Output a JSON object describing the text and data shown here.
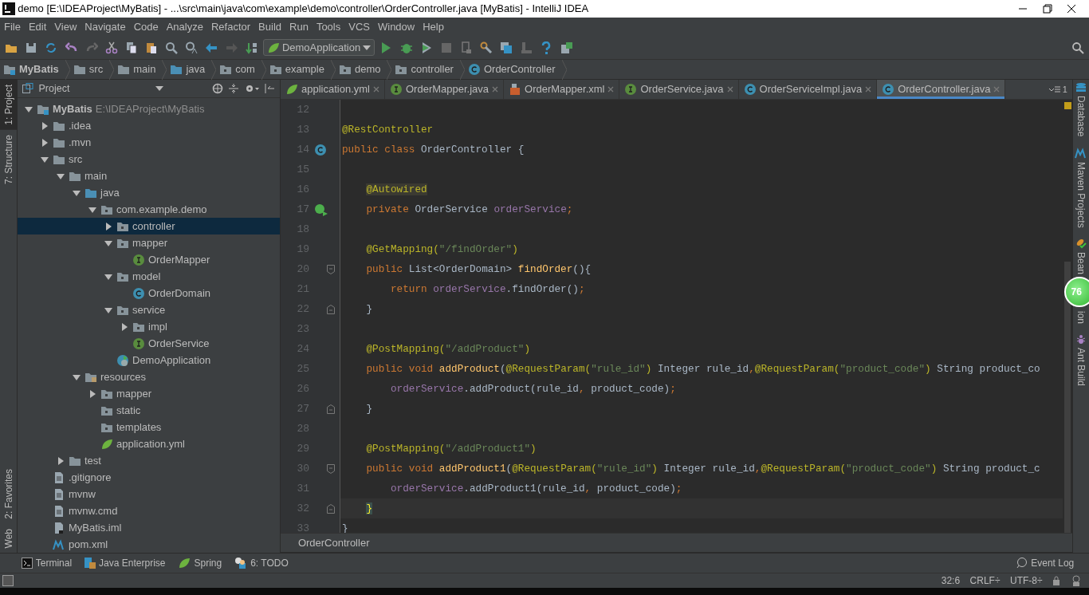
{
  "window": {
    "title": "demo [E:\\IDEAProject\\MyBatis] - ...\\src\\main\\java\\com\\example\\demo\\controller\\OrderController.java [MyBatis] - IntelliJ IDEA"
  },
  "menu": [
    "File",
    "Edit",
    "View",
    "Navigate",
    "Code",
    "Analyze",
    "Refactor",
    "Build",
    "Run",
    "Tools",
    "VCS",
    "Window",
    "Help"
  ],
  "run_config": "DemoApplication",
  "breadcrumbs": [
    {
      "label": "MyBatis",
      "kind": "module"
    },
    {
      "label": "src",
      "kind": "folder"
    },
    {
      "label": "main",
      "kind": "folder"
    },
    {
      "label": "java",
      "kind": "source"
    },
    {
      "label": "com",
      "kind": "package"
    },
    {
      "label": "example",
      "kind": "package"
    },
    {
      "label": "demo",
      "kind": "package"
    },
    {
      "label": "controller",
      "kind": "package"
    },
    {
      "label": "OrderController",
      "kind": "class"
    }
  ],
  "left_tools": [
    {
      "label": "1: Project",
      "selected": true
    },
    {
      "label": "7: Structure",
      "selected": false
    },
    {
      "label": "2: Favorites",
      "selected": false
    },
    {
      "label": "Web",
      "selected": false
    }
  ],
  "project_panel": {
    "title": "Project",
    "tree": [
      {
        "label": "MyBatis",
        "path": "E:\\IDEAProject\\MyBatis",
        "kind": "module",
        "expanded": true,
        "selected": false,
        "children": [
          {
            "label": ".idea",
            "kind": "folder",
            "expanded": false,
            "selected": false
          },
          {
            "label": ".mvn",
            "kind": "folder",
            "expanded": false,
            "selected": false
          },
          {
            "label": "src",
            "kind": "folder",
            "expanded": true,
            "selected": false,
            "children": [
              {
                "label": "main",
                "kind": "folder",
                "expanded": true,
                "selected": false,
                "children": [
                  {
                    "label": "java",
                    "kind": "source",
                    "expanded": true,
                    "selected": false,
                    "children": [
                      {
                        "label": "com.example.demo",
                        "kind": "package",
                        "expanded": true,
                        "selected": false,
                        "children": [
                          {
                            "label": "controller",
                            "kind": "package",
                            "expanded": false,
                            "selected": true
                          },
                          {
                            "label": "mapper",
                            "kind": "package",
                            "expanded": true,
                            "selected": false,
                            "children": [
                              {
                                "label": "OrderMapper",
                                "kind": "interface",
                                "selected": false
                              }
                            ]
                          },
                          {
                            "label": "model",
                            "kind": "package",
                            "expanded": true,
                            "selected": false,
                            "children": [
                              {
                                "label": "OrderDomain",
                                "kind": "class",
                                "selected": false
                              }
                            ]
                          },
                          {
                            "label": "service",
                            "kind": "package",
                            "expanded": true,
                            "selected": false,
                            "children": [
                              {
                                "label": "impl",
                                "kind": "package",
                                "expanded": false,
                                "selected": false
                              },
                              {
                                "label": "OrderService",
                                "kind": "interface",
                                "selected": false
                              }
                            ]
                          },
                          {
                            "label": "DemoApplication",
                            "kind": "springclass",
                            "selected": false
                          }
                        ]
                      }
                    ]
                  },
                  {
                    "label": "resources",
                    "kind": "resources",
                    "expanded": true,
                    "selected": false,
                    "children": [
                      {
                        "label": "mapper",
                        "kind": "package",
                        "expanded": false,
                        "selected": false
                      },
                      {
                        "label": "static",
                        "kind": "package",
                        "selected": false
                      },
                      {
                        "label": "templates",
                        "kind": "package",
                        "selected": false
                      },
                      {
                        "label": "application.yml",
                        "kind": "spring",
                        "selected": false
                      }
                    ]
                  }
                ]
              },
              {
                "label": "test",
                "kind": "folder",
                "expanded": false,
                "selected": false
              }
            ]
          },
          {
            "label": ".gitignore",
            "kind": "file",
            "selected": false
          },
          {
            "label": "mvnw",
            "kind": "file",
            "selected": false
          },
          {
            "label": "mvnw.cmd",
            "kind": "file",
            "selected": false
          },
          {
            "label": "MyBatis.iml",
            "kind": "iml",
            "selected": false
          },
          {
            "label": "pom.xml",
            "kind": "maven",
            "selected": false
          }
        ]
      }
    ]
  },
  "tabs": [
    {
      "label": "application.yml",
      "kind": "spring",
      "selected": false
    },
    {
      "label": "OrderMapper.java",
      "kind": "interface",
      "selected": false
    },
    {
      "label": "OrderMapper.xml",
      "kind": "xml",
      "selected": false
    },
    {
      "label": "OrderService.java",
      "kind": "interface",
      "selected": false
    },
    {
      "label": "OrderServiceImpl.java",
      "kind": "class",
      "selected": false
    },
    {
      "label": "OrderController.java",
      "kind": "class",
      "selected": true
    }
  ],
  "tab_overflow": "1",
  "code": [
    {
      "n": "12"
    },
    {
      "n": "13",
      "tokens": [
        {
          "t": "@RestController",
          "kind": "ann"
        }
      ]
    },
    {
      "n": "14",
      "kind": "class",
      "tokens": [
        {
          "t": "public class ",
          "kind": "kw"
        },
        {
          "t": "OrderController {",
          "kind": "plain"
        }
      ]
    },
    {
      "n": "15"
    },
    {
      "n": "16",
      "tokens": [
        {
          "t": "    @Autowired",
          "kind": "annhl"
        }
      ]
    },
    {
      "n": "17",
      "kind": "bean",
      "tokens": [
        {
          "t": "    private ",
          "kind": "kw"
        },
        {
          "t": "OrderService ",
          "kind": "plain"
        },
        {
          "t": "orderService",
          "kind": "fld"
        },
        {
          "t": ";",
          "kind": "kw"
        }
      ]
    },
    {
      "n": "18"
    },
    {
      "n": "19",
      "tokens": [
        {
          "t": "    @GetMapping(",
          "kind": "ann"
        },
        {
          "t": "\"/findOrder\"",
          "kind": "str"
        },
        {
          "t": ")",
          "kind": "ann"
        }
      ]
    },
    {
      "n": "20",
      "kind": "fold-start",
      "tokens": [
        {
          "t": "    public ",
          "kind": "kw"
        },
        {
          "t": "List<OrderDomain> ",
          "kind": "plain"
        },
        {
          "t": "findOrder",
          "kind": "fn"
        },
        {
          "t": "(){",
          "kind": "plain"
        }
      ]
    },
    {
      "n": "21",
      "tokens": [
        {
          "t": "        return ",
          "kind": "kw"
        },
        {
          "t": "orderService",
          "kind": "fld"
        },
        {
          "t": ".findOrder()",
          "kind": "plain"
        },
        {
          "t": ";",
          "kind": "kw"
        }
      ]
    },
    {
      "n": "22",
      "kind": "fold-end",
      "tokens": [
        {
          "t": "    }",
          "kind": "plain"
        }
      ]
    },
    {
      "n": "23"
    },
    {
      "n": "24",
      "tokens": [
        {
          "t": "    @PostMapping(",
          "kind": "ann"
        },
        {
          "t": "\"/addProduct\"",
          "kind": "str"
        },
        {
          "t": ")",
          "kind": "ann"
        }
      ]
    },
    {
      "n": "25",
      "tokens": [
        {
          "t": "    public void ",
          "kind": "kw"
        },
        {
          "t": "addProduct",
          "kind": "fn"
        },
        {
          "t": "(",
          "kind": "plain"
        },
        {
          "t": "@RequestParam(",
          "kind": "ann"
        },
        {
          "t": "\"rule_id\"",
          "kind": "str"
        },
        {
          "t": ")",
          "kind": "ann"
        },
        {
          "t": " Integer rule_id",
          "kind": "plain"
        },
        {
          "t": ",",
          "kind": "kw"
        },
        {
          "t": "@RequestParam(",
          "kind": "ann"
        },
        {
          "t": "\"product_code\"",
          "kind": "str"
        },
        {
          "t": ")",
          "kind": "ann"
        },
        {
          "t": " String product_co",
          "kind": "plain"
        }
      ]
    },
    {
      "n": "26",
      "tokens": [
        {
          "t": "        orderService",
          "kind": "fld"
        },
        {
          "t": ".addProduct(rule_id",
          "kind": "plain"
        },
        {
          "t": ", ",
          "kind": "kw"
        },
        {
          "t": "product_code)",
          "kind": "plain"
        },
        {
          "t": ";",
          "kind": "kw"
        }
      ]
    },
    {
      "n": "27",
      "kind": "fold-end",
      "tokens": [
        {
          "t": "    }",
          "kind": "plain"
        }
      ]
    },
    {
      "n": "28"
    },
    {
      "n": "29",
      "tokens": [
        {
          "t": "    @PostMapping(",
          "kind": "ann"
        },
        {
          "t": "\"/addProduct1\"",
          "kind": "str"
        },
        {
          "t": ")",
          "kind": "ann"
        }
      ]
    },
    {
      "n": "30",
      "kind": "fold-start",
      "tokens": [
        {
          "t": "    public void ",
          "kind": "kw"
        },
        {
          "t": "addProduct1",
          "kind": "fn"
        },
        {
          "t": "(",
          "kind": "plain"
        },
        {
          "t": "@RequestParam(",
          "kind": "ann"
        },
        {
          "t": "\"rule_id\"",
          "kind": "str"
        },
        {
          "t": ")",
          "kind": "ann"
        },
        {
          "t": " Integer rule_id",
          "kind": "plain"
        },
        {
          "t": ",",
          "kind": "kw"
        },
        {
          "t": "@RequestParam(",
          "kind": "ann"
        },
        {
          "t": "\"product_code\"",
          "kind": "str"
        },
        {
          "t": ")",
          "kind": "ann"
        },
        {
          "t": " String product_c",
          "kind": "plain"
        }
      ]
    },
    {
      "n": "31",
      "tokens": [
        {
          "t": "        orderService",
          "kind": "fld"
        },
        {
          "t": ".addProduct1(rule_id",
          "kind": "plain"
        },
        {
          "t": ", ",
          "kind": "kw"
        },
        {
          "t": "product_code)",
          "kind": "plain"
        },
        {
          "t": ";",
          "kind": "kw"
        }
      ]
    },
    {
      "n": "32",
      "kind": "fold-end",
      "current": true,
      "tokens": [
        {
          "t": "    }",
          "kind": "match"
        }
      ]
    },
    {
      "n": "33",
      "tokens": [
        {
          "t": "}",
          "kind": "plain"
        }
      ]
    }
  ],
  "editor_breadcrumb": "OrderController",
  "right_tools": [
    {
      "label": "Database",
      "kind": "database"
    },
    {
      "label": "Maven Projects",
      "kind": "maven"
    },
    {
      "label": "Bean",
      "tail": "ion",
      "kind": "bean"
    },
    {
      "label": "Ant Build",
      "kind": "ant"
    }
  ],
  "memory_badge": "76",
  "bottom_tools": [
    {
      "label": "Terminal",
      "kind": "terminal"
    },
    {
      "label": "Java Enterprise",
      "kind": "javaee"
    },
    {
      "label": "Spring",
      "kind": "spring"
    },
    {
      "label": "6: TODO",
      "kind": "todo"
    }
  ],
  "event_log": "Event Log",
  "status": [
    "32:6",
    "CRLF÷",
    "UTF-8÷"
  ]
}
